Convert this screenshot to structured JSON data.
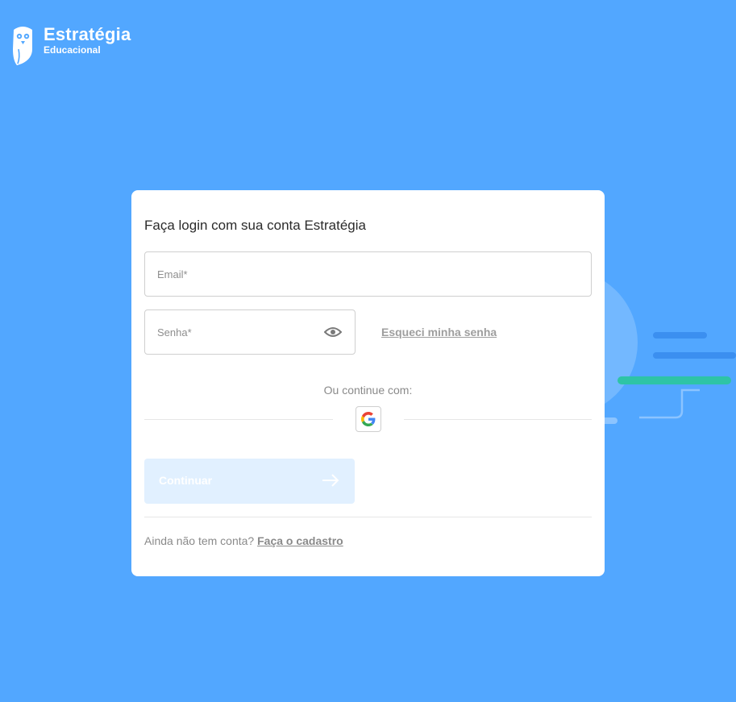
{
  "brand": {
    "name": "Estratégia",
    "subtitle": "Educacional"
  },
  "login": {
    "title": "Faça login com sua conta Estratégia",
    "email_placeholder": "Email*",
    "password_placeholder": "Senha*",
    "forgot_password": "Esqueci minha senha",
    "or_continue": "Ou continue com:",
    "google_icon": "google-icon",
    "continue_label": "Continuar",
    "signup_prompt": "Ainda não tem conta?",
    "signup_link": "Faça o cadastro"
  },
  "colors": {
    "background": "#52a7ff",
    "card": "#ffffff",
    "continue_button_disabled": "#e1f0ff",
    "accent_green": "#2ec4a6"
  }
}
